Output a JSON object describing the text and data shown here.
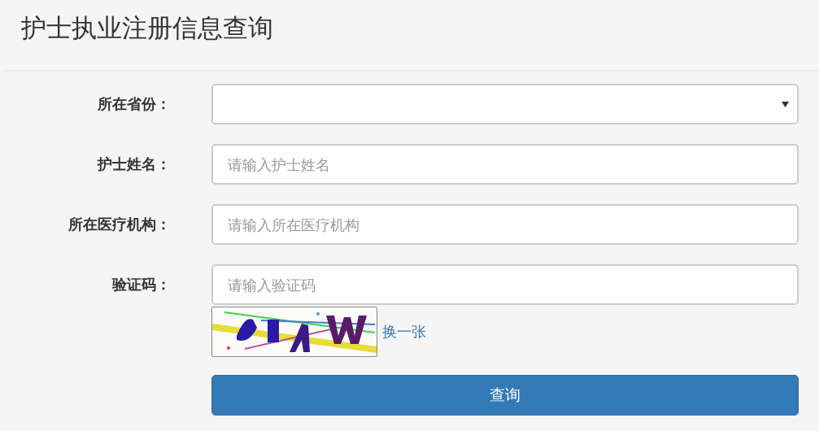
{
  "title": "护士执业注册信息查询",
  "fields": [
    {
      "kind": "select",
      "label": "所在省份："
    },
    {
      "kind": "text",
      "label": "护士姓名：",
      "placeholder": "请输入护士姓名"
    },
    {
      "kind": "text",
      "label": "所在医疗机构：",
      "placeholder": "请输入所在医疗机构"
    },
    {
      "kind": "text",
      "label": "验证码：",
      "placeholder": "请输入验证码"
    }
  ],
  "captcha": {
    "kind": "picture",
    "refresh_link": "换一张"
  },
  "submit_button": "查询"
}
